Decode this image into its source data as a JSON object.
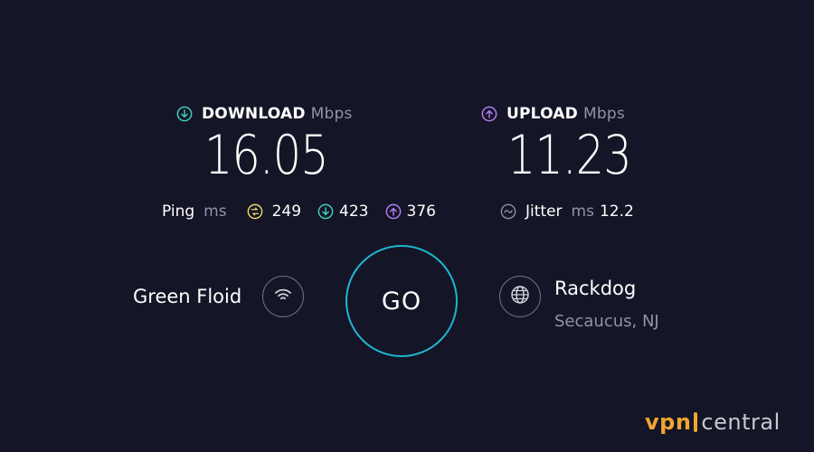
{
  "download": {
    "label": "DOWNLOAD",
    "unit": "Mbps",
    "value": "16.05",
    "icon": "arrow-down-circle-icon",
    "color": "#3fd1c4"
  },
  "upload": {
    "label": "UPLOAD",
    "unit": "Mbps",
    "value": "11.23",
    "icon": "arrow-up-circle-icon",
    "color": "#b57cf5"
  },
  "ping": {
    "label": "Ping",
    "unit": "ms",
    "idle": "249",
    "download": "423",
    "upload": "376",
    "idle_color": "#e9d86a"
  },
  "jitter": {
    "label": "Jitter",
    "unit": "ms",
    "value": "12.2"
  },
  "go_button": {
    "label": "GO",
    "color": "#1fb6cf"
  },
  "isp": {
    "name": "Green Floid",
    "icon": "wifi-icon"
  },
  "server": {
    "name": "Rackdog",
    "location": "Secaucus, NJ",
    "icon": "globe-icon"
  },
  "watermark": {
    "vpn": "vpn",
    "central": "central"
  }
}
